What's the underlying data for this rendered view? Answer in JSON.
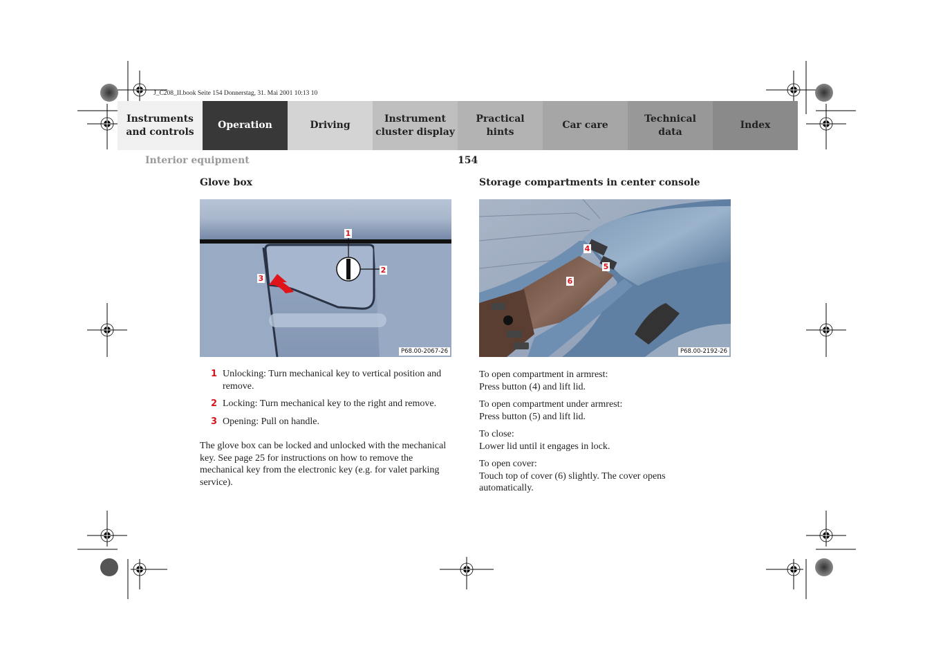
{
  "slug": "J_C208_II.book  Seite 154  Donnerstag, 31. Mai 2001  10:13 10",
  "tabs": [
    {
      "label": "Instruments\nand controls",
      "bg": "#f0f0f0",
      "fg": "#222222",
      "active": false
    },
    {
      "label": "Operation",
      "bg": "#383838",
      "fg": "#ffffff",
      "active": true
    },
    {
      "label": "Driving",
      "bg": "#d4d4d4",
      "fg": "#222222",
      "active": false
    },
    {
      "label": "Instrument\ncluster display",
      "bg": "#bfbfbf",
      "fg": "#222222",
      "active": false
    },
    {
      "label": "Practical hints",
      "bg": "#b3b3b3",
      "fg": "#222222",
      "active": false
    },
    {
      "label": "Car care",
      "bg": "#a6a6a6",
      "fg": "#222222",
      "active": false
    },
    {
      "label": "Technical\ndata",
      "bg": "#989898",
      "fg": "#222222",
      "active": false
    },
    {
      "label": "Index",
      "bg": "#8a8a8a",
      "fg": "#222222",
      "active": false
    }
  ],
  "header": {
    "section": "Interior equipment",
    "page_number": "154"
  },
  "left": {
    "title": "Glove box",
    "figure": {
      "code": "P68.00-2067-26",
      "callouts": [
        "1",
        "2",
        "3"
      ]
    },
    "items": [
      {
        "num": "1",
        "text": "Unlocking: Turn mechanical key to vertical position and remove."
      },
      {
        "num": "2",
        "text": "Locking: Turn mechanical key to the right and remove."
      },
      {
        "num": "3",
        "text": "Opening: Pull on handle."
      }
    ],
    "paragraph": "The glove box can be locked and unlocked with the mechanical key. See page 25 for instructions on how to remove the mechanical key from the electronic key (e.g. for valet parking service)."
  },
  "right": {
    "title": "Storage compartments in center console",
    "figure": {
      "code": "P68.00-2192-26",
      "callouts": [
        "4",
        "5",
        "6"
      ]
    },
    "paragraphs": [
      {
        "line1": "To open compartment in armrest:",
        "line2": "Press button (4) and lift lid."
      },
      {
        "line1": "To open compartment under armrest:",
        "line2": "Press button (5) and lift lid."
      },
      {
        "line1": "To close:",
        "line2": "Lower lid until it engages in lock."
      },
      {
        "line1": "To open cover:",
        "line2": "Touch top of cover (6) slightly. The cover opens automatically."
      }
    ]
  },
  "colors": {
    "callout": "#d8141b",
    "section_gray": "#9a9a9a"
  }
}
